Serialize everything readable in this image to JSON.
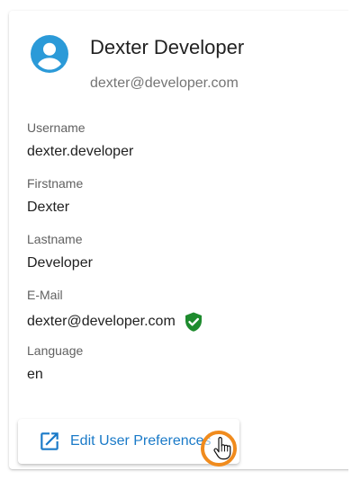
{
  "profile": {
    "name": "Dexter Developer",
    "email": "dexter@developer.com"
  },
  "fields": [
    {
      "label": "Username",
      "value": "dexter.developer"
    },
    {
      "label": "Firstname",
      "value": "Dexter"
    },
    {
      "label": "Lastname",
      "value": "Developer"
    },
    {
      "label": "E-Mail",
      "value": "dexter@developer.com",
      "verified": true
    },
    {
      "label": "Language",
      "value": "en"
    }
  ],
  "actions": {
    "edit_preferences_label": "Edit User Preferences"
  },
  "colors": {
    "accent": "#1a7ac8",
    "avatar": "#2b9ad8",
    "verified": "#1e8b2e",
    "cursor_highlight": "#f08b1d"
  },
  "icons": {
    "avatar": "account-circle-icon",
    "verified": "shield-check-icon",
    "edit": "open-in-new-icon",
    "cursor": "hand-pointer-icon"
  }
}
